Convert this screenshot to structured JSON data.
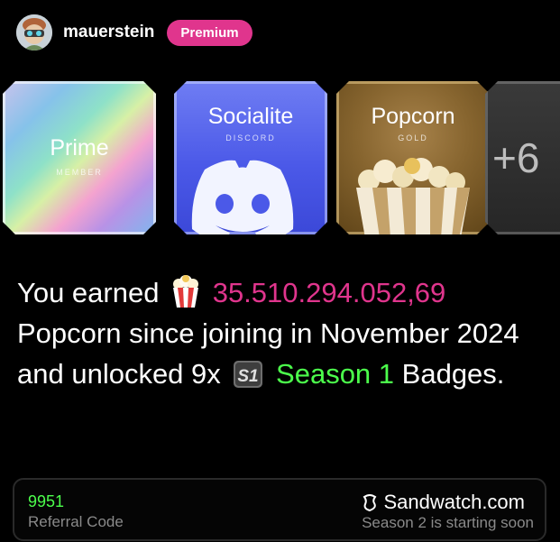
{
  "profile": {
    "username": "mauerstein",
    "badge_label": "Premium",
    "badge_color": "#e0358d"
  },
  "badges": [
    {
      "title": "Prime",
      "subtitle": "MEMBER"
    },
    {
      "title": "Socialite",
      "subtitle": "DISCORD",
      "icon": "discord-icon"
    },
    {
      "title": "Popcorn",
      "subtitle": "GOLD",
      "icon": "popcorn-icon"
    },
    {
      "title": "+6"
    }
  ],
  "earned": {
    "prefix": "You earned",
    "amount": "35.510.294.052,69",
    "middle": "Popcorn since joining in November 2024 and unlocked 9x",
    "season_name": "Season 1",
    "suffix": "Badges.",
    "amount_color": "#e0358d",
    "season_color": "#4cff4c"
  },
  "footer": {
    "referral_code": "9951",
    "referral_label": "Referral Code",
    "site_name": "Sandwatch.com",
    "season_status": "Season 2 is starting soon"
  }
}
